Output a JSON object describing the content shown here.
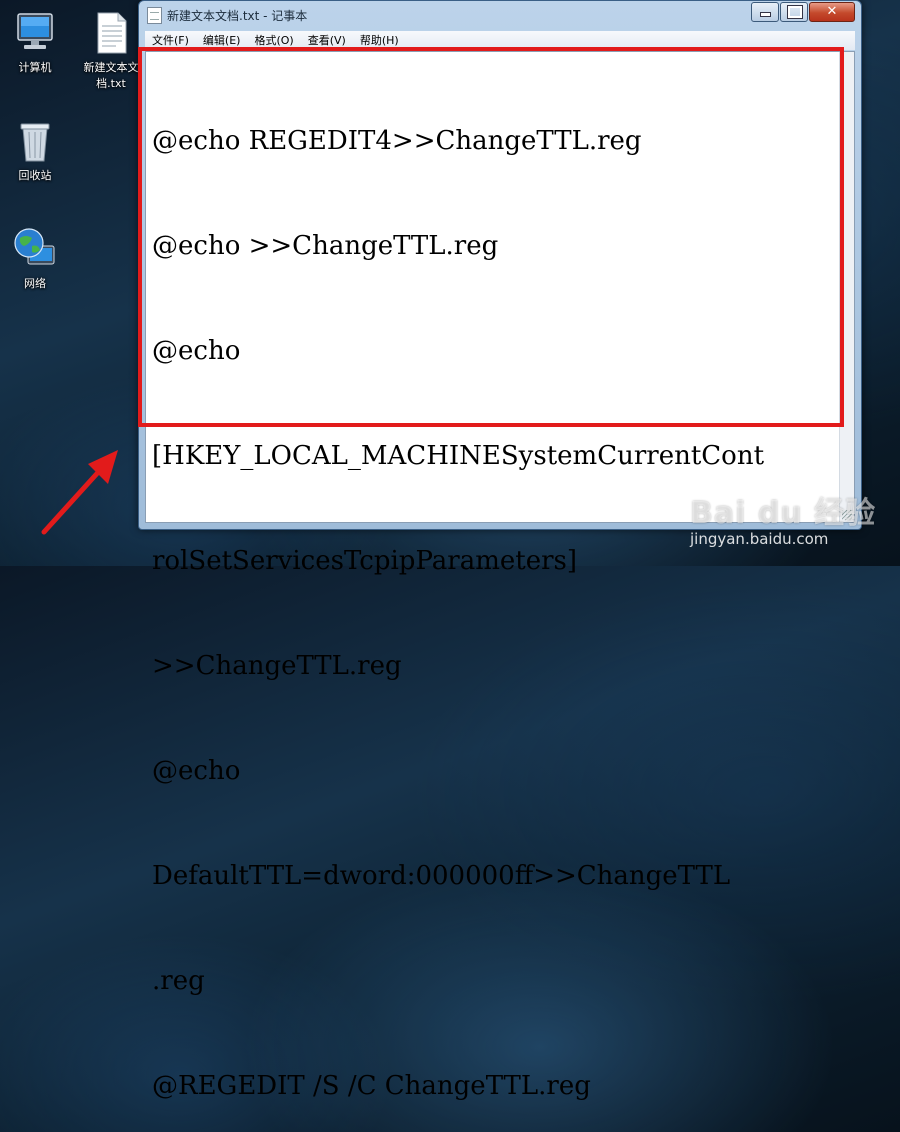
{
  "desktop": {
    "icons": [
      {
        "label": "计算机"
      },
      {
        "label": "新建文本文档.txt"
      },
      {
        "label": "回收站"
      },
      {
        "label": "网络"
      }
    ]
  },
  "window": {
    "title": "新建文本文档.txt - 记事本",
    "menu": [
      "文件(F)",
      "编辑(E)",
      "格式(O)",
      "查看(V)",
      "帮助(H)"
    ],
    "content_lines": [
      "@echo REGEDIT4>>ChangeTTL.reg",
      "@echo >>ChangeTTL.reg",
      "@echo",
      "[HKEY_LOCAL_MACHINESystemCurrentCont",
      "rolSetServicesTcpipParameters]",
      ">>ChangeTTL.reg",
      "@echo",
      "DefaultTTL=dword:000000ff>>ChangeTTL",
      ".reg",
      "@REGEDIT /S /C ChangeTTL.reg"
    ]
  },
  "watermark": {
    "logo": "Bai du 经验",
    "url": "jingyan.baidu.com"
  },
  "colors": {
    "highlight": "#e21b1b",
    "arrow": "#e21b1b",
    "close_button": "#c44a2c"
  },
  "icons": [
    "computer-icon",
    "text-file-icon",
    "recycle-bin-icon",
    "network-icon",
    "notepad-icon",
    "minimize-icon",
    "maximize-icon",
    "close-icon"
  ]
}
